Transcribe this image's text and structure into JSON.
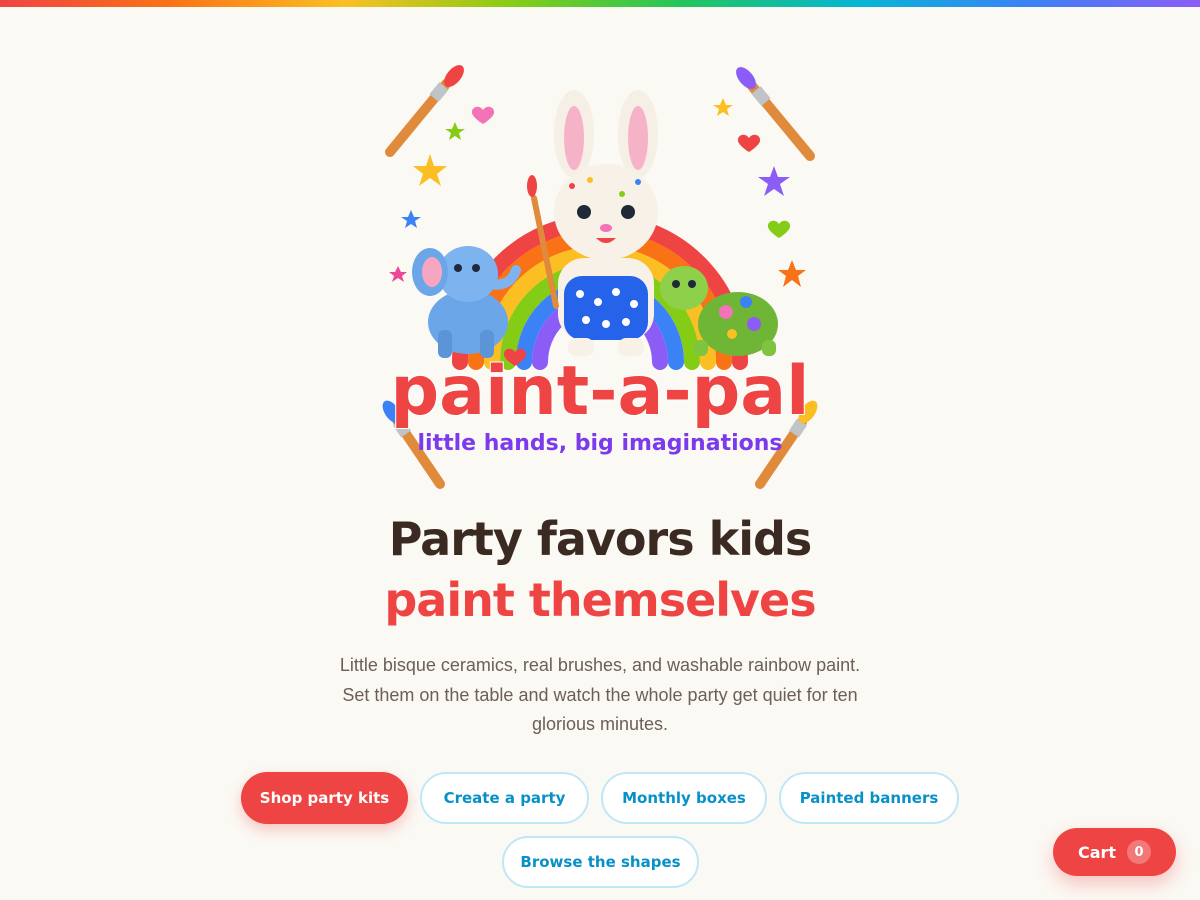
{
  "brand": {
    "logo_text": "paint-a-pal",
    "logo_tagline": "little hands, big imaginations"
  },
  "hero": {
    "headline_line1": "Party favors kids",
    "headline_line2": "paint themselves",
    "subtext": "Little bisque ceramics, real brushes, and washable rainbow paint. Set them on the table and watch the whole party get quiet for ten glorious minutes."
  },
  "actions": {
    "primary": "Shop party kits",
    "create_party": "Create a party",
    "monthly_boxes": "Monthly boxes",
    "painted_banners": "Painted banners",
    "browse_shapes": "Browse the shapes"
  },
  "cart": {
    "label": "Cart",
    "count": "0"
  },
  "colors": {
    "accent_red": "#ef4444",
    "link_blue": "#0891c7",
    "outline_border": "#bfe7f7",
    "heading_brown": "#3b2a22",
    "page_background": "#fbf9f4"
  }
}
